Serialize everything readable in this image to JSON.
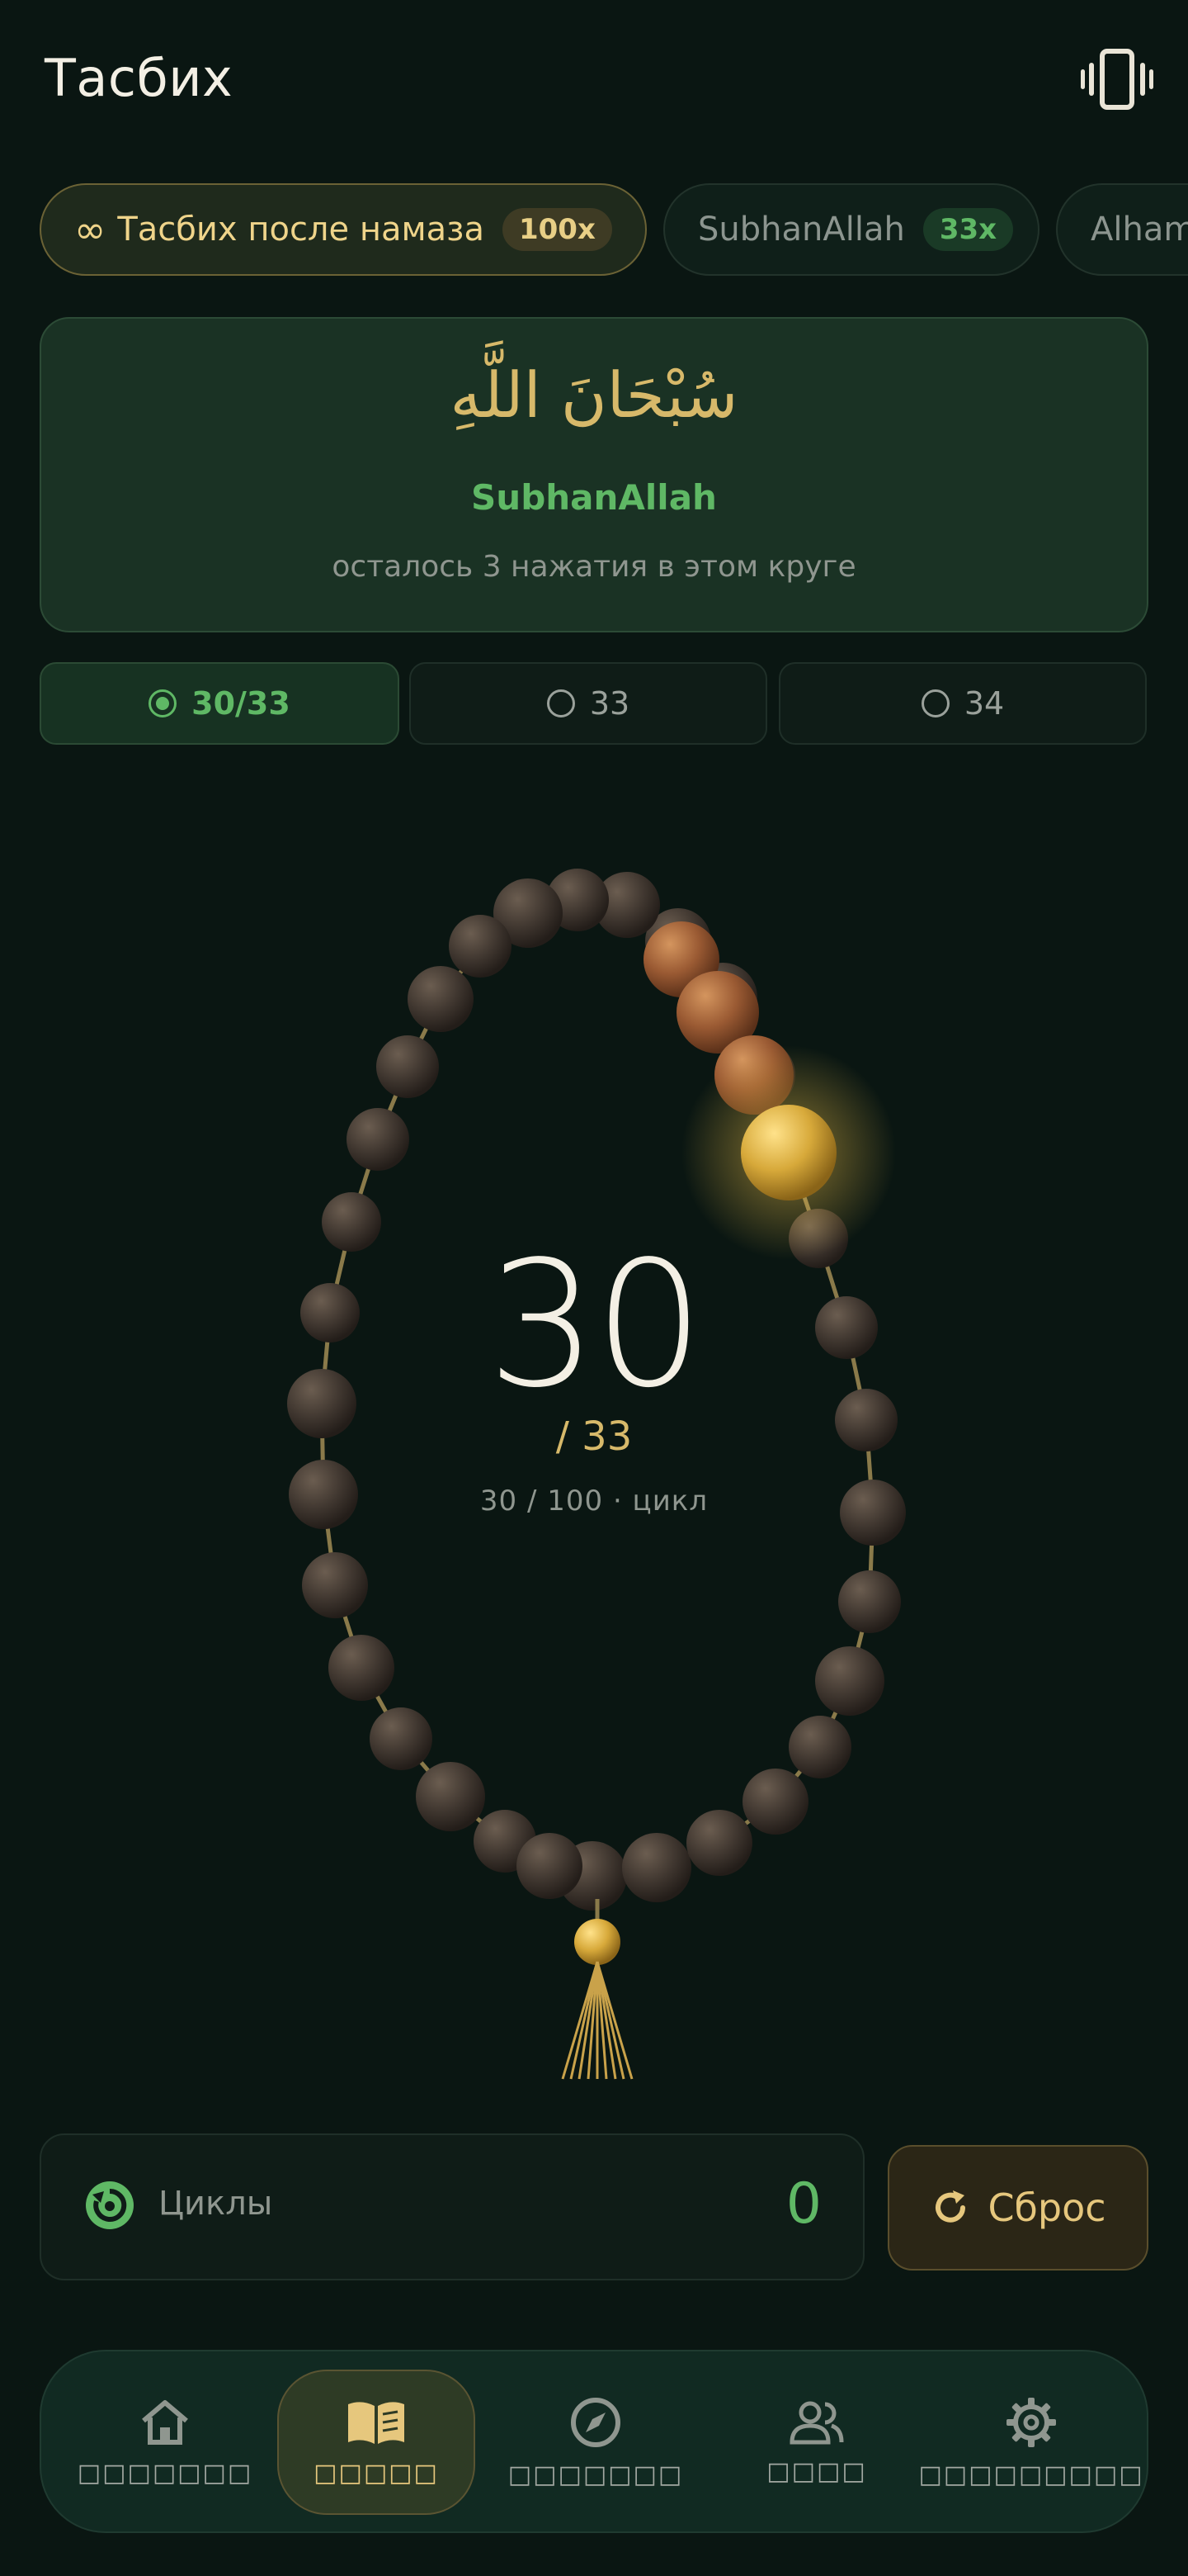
{
  "header": {
    "title": "Тасбих"
  },
  "chips": [
    {
      "label": "Тасбих после намаза",
      "badge": "100x"
    },
    {
      "label": "SubhanAllah",
      "badge": "33x"
    },
    {
      "label": "Alham"
    }
  ],
  "dhikr": {
    "arabic": "سُبْحَانَ اللَّهِ",
    "transliteration": "SubhanAllah",
    "remaining": "осталось 3 нажатия в этом круге"
  },
  "modes": [
    {
      "label": "30/33",
      "selected": true
    },
    {
      "label": "33",
      "selected": false
    },
    {
      "label": "34",
      "selected": false
    }
  ],
  "counter": {
    "count": "30",
    "target": "/ 33",
    "cycle_info": "30 / 100 · цикл"
  },
  "beads": {
    "total": 33,
    "done": 30
  },
  "cycles": {
    "label": "Циклы",
    "count": "0"
  },
  "reset": {
    "label": "Сброс"
  },
  "nav": [
    {
      "label": "□□□□□□□",
      "icon": "home-icon"
    },
    {
      "label": "□□□□□",
      "icon": "book-icon",
      "active": true
    },
    {
      "label": "□□□□□□□",
      "icon": "compass-icon"
    },
    {
      "label": "□□□□",
      "icon": "people-icon"
    },
    {
      "label": "□□□□□□□□□",
      "icon": "gear-icon"
    }
  ],
  "colors": {
    "accent_gold": "#e6c77d",
    "accent_green": "#5fb865",
    "background": "#0a1612"
  }
}
